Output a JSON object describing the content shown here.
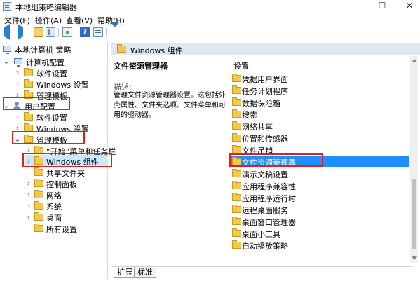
{
  "window": {
    "title": "本地组策略编辑器",
    "min": "—",
    "max": "☐",
    "close": "✕"
  },
  "menu": [
    "文件(F)",
    "操作(A)",
    "查看(V)",
    "帮助(H)"
  ],
  "toolbar": {
    "help": "?"
  },
  "tree": {
    "root": "本地计算机 策略",
    "computer_config": "计算机配置",
    "computer_children": [
      "软件设置",
      "Windows 设置",
      "管理模板"
    ],
    "user_config": "用户配置",
    "user_children": [
      "软件设置",
      "Windows 设置",
      "管理模板"
    ],
    "admin_children": [
      "“开始”菜单和任务栏",
      "Windows 组件",
      "共享文件夹",
      "控制面板",
      "网络",
      "系统",
      "桌面",
      "所有设置"
    ]
  },
  "right": {
    "header": "Windows 组件",
    "desc_title": "文件资源管理器",
    "desc_label": "描述:",
    "desc_text": "管理文件资源管理器设置。这包括外壳属性、文件夹选项、文件菜单和可用的驱动器。",
    "col_header": "设置",
    "items": [
      "凭据用户界面",
      "任务计划程序",
      "数据保险箱",
      "搜索",
      "网络共享",
      "位置和传感器",
      "文件吊销",
      "文件资源管理器",
      "演示文稿设置",
      "应用程序兼容性",
      "应用程序运行时",
      "远程桌面服务",
      "桌面窗口管理器",
      "桌面小工具",
      "自动播放策略"
    ],
    "selected_index": 7
  },
  "tabs": [
    "扩展",
    "标准"
  ]
}
